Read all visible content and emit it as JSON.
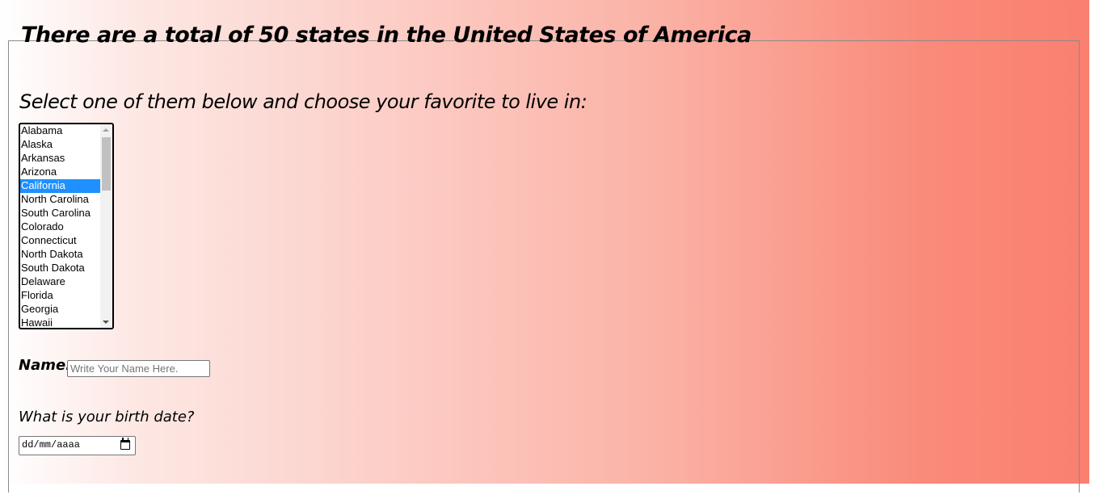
{
  "form": {
    "legend": "There are a total of 50 states in the United States of America",
    "subheading": "Select one of them below and choose your favorite to live in:",
    "states": [
      "Alabama",
      "Alaska",
      "Arkansas",
      "Arizona",
      "California",
      "North Carolina",
      "South Carolina",
      "Colorado",
      "Connecticut",
      "North Dakota",
      "South Dakota",
      "Delaware",
      "Florida",
      "Georgia",
      "Hawaii"
    ],
    "selected_state": "California",
    "name_label": "Name:",
    "name_placeholder": "Write Your Name Here.",
    "birth_label": "What is your birth date?",
    "date_placeholder": "dd/mm/aaaa"
  },
  "colors": {
    "gradient_start": "#ffffff",
    "gradient_end": "#fa8070",
    "selection": "#1e90ff"
  },
  "icons": {
    "date_picker": "calendar-icon",
    "scroll_up": "scroll-up-arrow-icon",
    "scroll_down": "scroll-down-arrow-icon"
  }
}
